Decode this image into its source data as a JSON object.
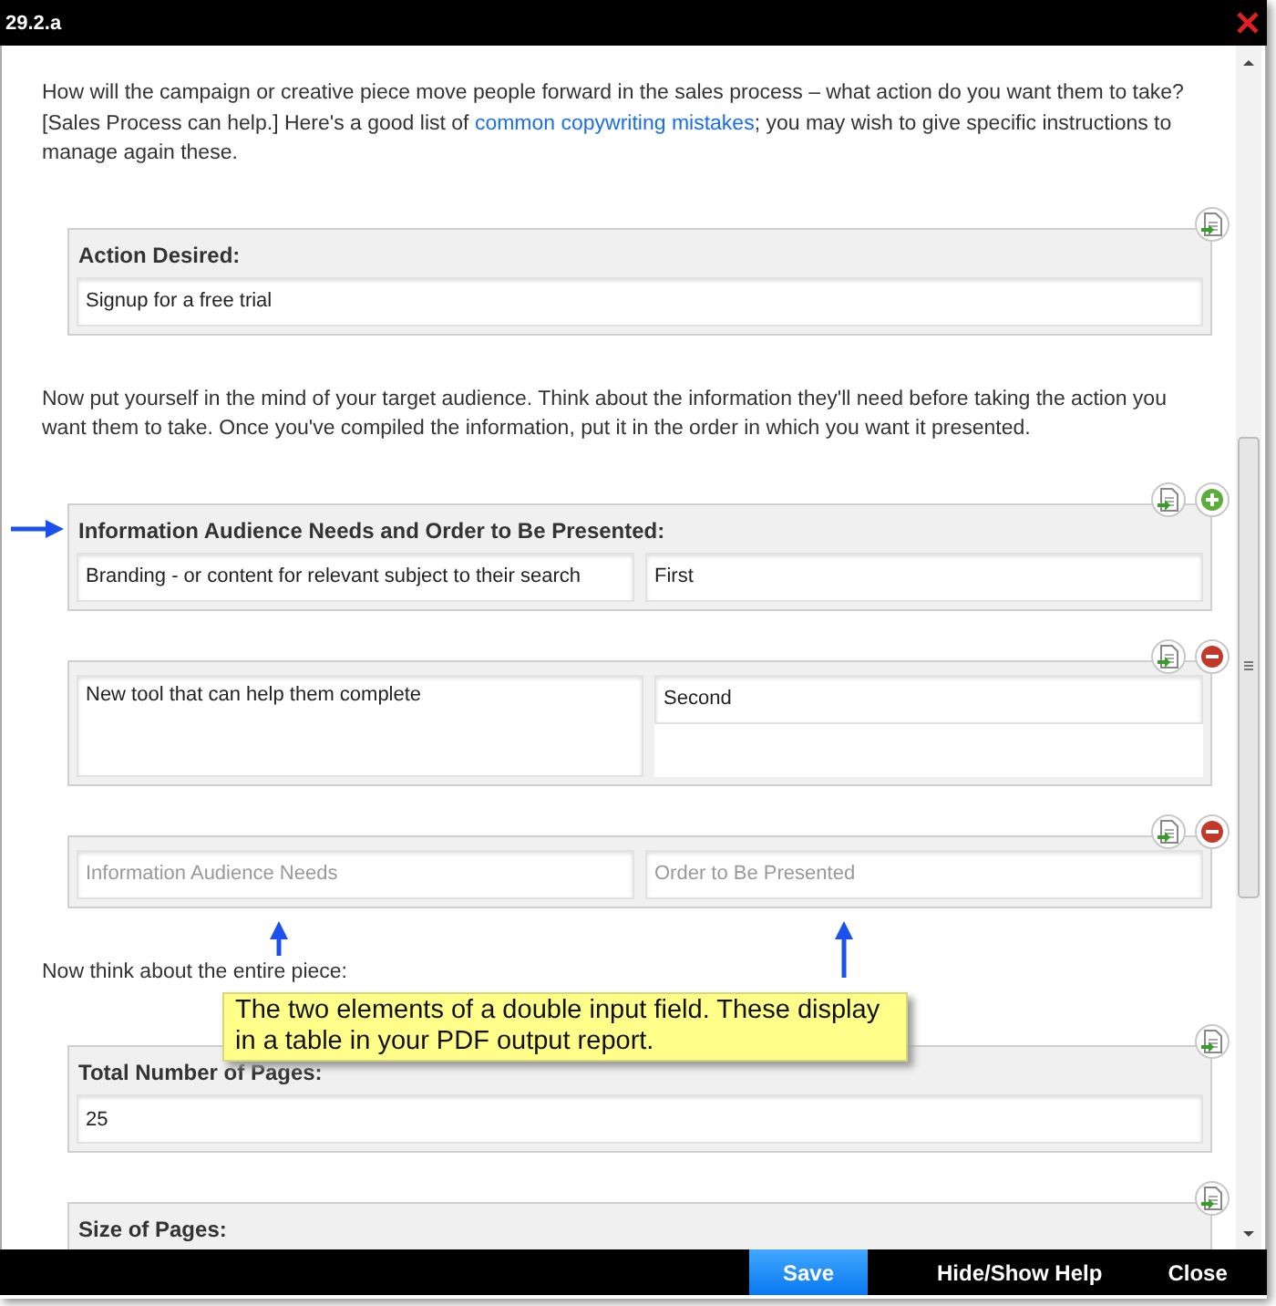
{
  "window": {
    "title": "29.2.a"
  },
  "content": [
    {
      "kind": "paragraph",
      "text": "How will the campaign or creative piece move people forward in the sales process – what action do you want them to take? [Sales Process can help.]  Here's a good list of ",
      "link": "common copywriting mistakes",
      "text_after": "; you may wish to give specific instructions to manage again these."
    },
    {
      "kind": "panel",
      "label": "Action Desired:",
      "actions": [
        {
          "kind": "export"
        }
      ],
      "fields": [
        {
          "kind": "input",
          "value": "Signup for a free trial"
        }
      ]
    },
    {
      "kind": "paragraph",
      "text": "Now put yourself in the mind of your target audience. Think about the information they'll need before taking the action you want them to take. Once you've compiled the information, put it in the order in which you want it presented."
    },
    {
      "kind": "panel",
      "label": "Information Audience Needs and Order to Be Presented:",
      "actions": [
        {
          "kind": "export"
        },
        {
          "kind": "add"
        }
      ],
      "fields": [
        {
          "kind": "input",
          "value": "Branding - or content for relevant subject to their search"
        },
        {
          "kind": "input",
          "value": "First"
        }
      ]
    },
    {
      "kind": "panel",
      "actions": [
        {
          "kind": "export"
        },
        {
          "kind": "remove"
        }
      ],
      "fields": [
        {
          "kind": "textarea",
          "value": "New tool that can help them complete"
        },
        {
          "kind": "input",
          "value": "Second"
        }
      ]
    },
    {
      "kind": "panel",
      "actions": [
        {
          "kind": "export"
        },
        {
          "kind": "remove"
        }
      ],
      "fields": [
        {
          "kind": "input",
          "placeholder": "Information Audience Needs"
        },
        {
          "kind": "input",
          "placeholder": "Order to Be Presented"
        }
      ]
    },
    {
      "kind": "paragraph",
      "text": "Now think about the entire piece:"
    },
    {
      "kind": "panel",
      "label": "Total Number of Pages:",
      "actions": [
        {
          "kind": "export"
        }
      ],
      "fields": [
        {
          "kind": "input",
          "value": "25"
        }
      ]
    },
    {
      "kind": "panel",
      "label": "Size of Pages:",
      "actions": [
        {
          "kind": "export"
        }
      ]
    }
  ],
  "footer": {
    "buttons": [
      {
        "label": "Save",
        "kind": "primary"
      },
      {
        "label": "Hide/Show Help",
        "kind": "plain"
      },
      {
        "label": "Close",
        "kind": "plain"
      }
    ]
  },
  "help": {
    "callout": "The two elements of a double input field. These display in a table in your PDF output report."
  }
}
